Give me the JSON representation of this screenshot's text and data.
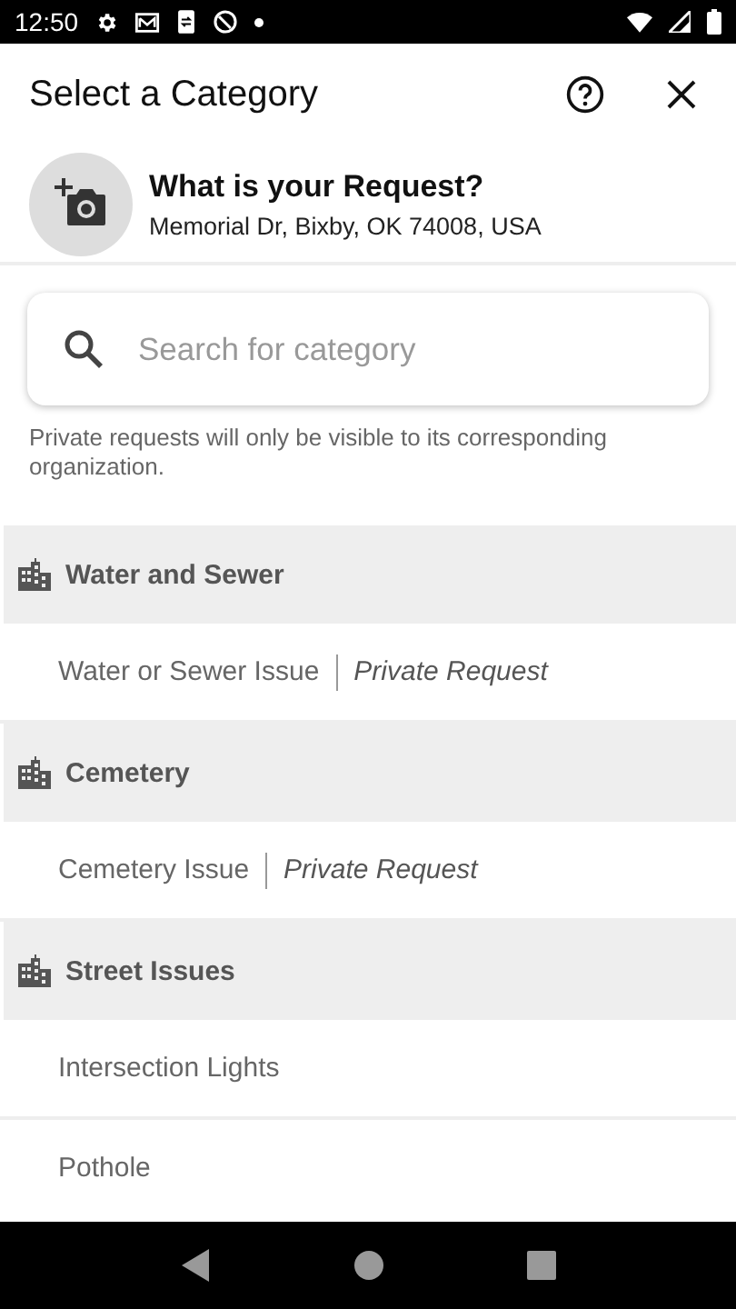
{
  "status_bar": {
    "time": "12:50"
  },
  "header": {
    "title": "Select a Category"
  },
  "request": {
    "title": "What is your Request?",
    "address": "Memorial Dr, Bixby, OK 74008, USA"
  },
  "search": {
    "placeholder": "Search for category"
  },
  "note": "Private requests will only be visible to its corresponding organization.",
  "groups": [
    {
      "name": "Water and Sewer",
      "items": [
        {
          "label": "Water or Sewer Issue",
          "tag": "Private Request"
        }
      ]
    },
    {
      "name": "Cemetery",
      "items": [
        {
          "label": "Cemetery Issue",
          "tag": "Private Request"
        }
      ]
    },
    {
      "name": "Street Issues",
      "items": [
        {
          "label": "Intersection Lights"
        },
        {
          "label": "Pothole"
        }
      ]
    }
  ]
}
